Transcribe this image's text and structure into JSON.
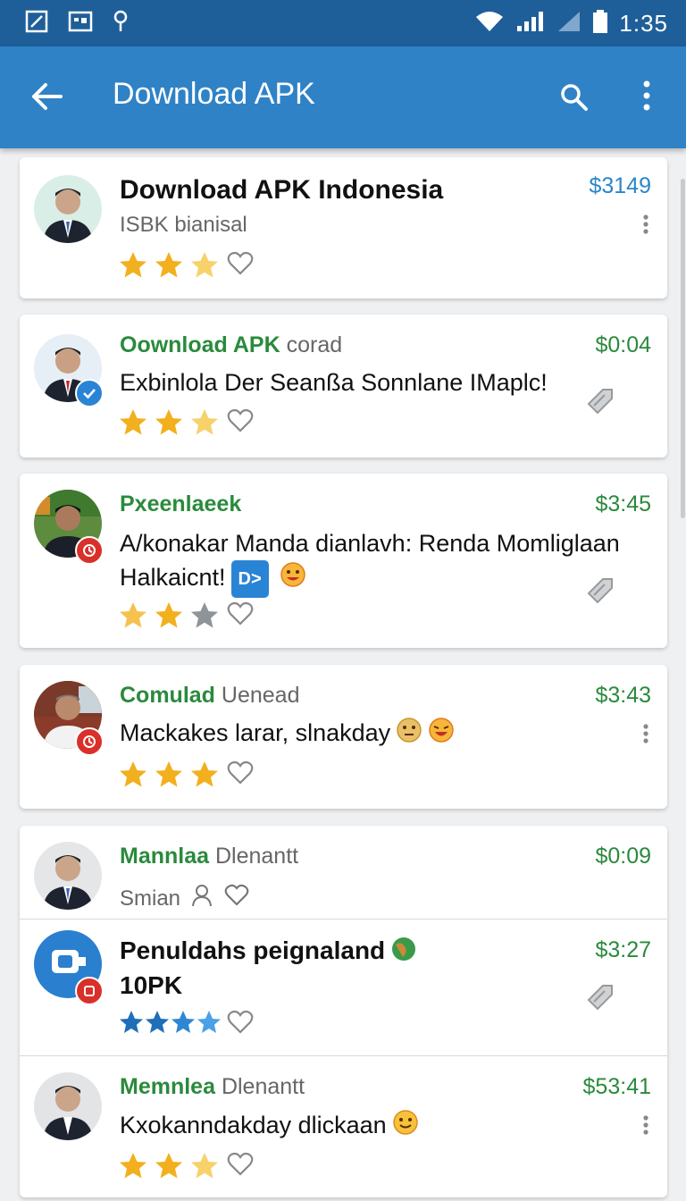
{
  "status_bar": {
    "time": "1:35"
  },
  "app_bar": {
    "title": "Download APK"
  },
  "items": [
    {
      "headline": "Download APK Indonesia",
      "subtitle": "ISBK bianisal",
      "price": "$3149"
    },
    {
      "name_green": "Oownload APK",
      "name_gray": "corad",
      "text": "Exbinlola Der Seanßa Sonnlane IMaplc!",
      "price": "$0:04"
    },
    {
      "name_green": "Pxeenlaeek",
      "name_gray": "",
      "text1": "A/konakar Manda dianlavh: Renda Momliglaan",
      "text2": "Halkaicnt!",
      "chip": "D>",
      "price": "$3:45"
    },
    {
      "name_green": "Comulad",
      "name_gray": "Uenead",
      "text": "Mackakes larar, slnakday",
      "price": "$3:43"
    },
    {
      "name_green": "Mannlaa",
      "name_gray": "Dlenantt",
      "subtitle": "Smian",
      "price": "$0:09"
    },
    {
      "headline1": "Penuldahs peignaland",
      "headline2": "10PK",
      "price": "$3:27"
    },
    {
      "name_green": "Memnlea",
      "name_gray": "Dlenantt",
      "text": "Kxokanndakday dlickaan",
      "price": "$53:41"
    }
  ]
}
